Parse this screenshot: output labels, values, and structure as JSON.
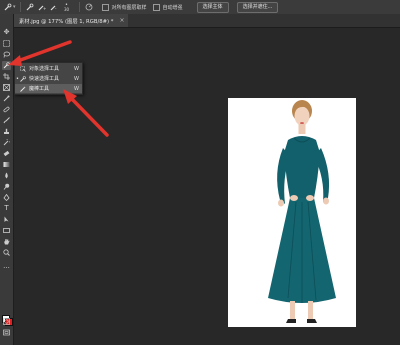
{
  "options_bar": {
    "sample_all_layers_label": "对所有图层取样",
    "auto_enhance_label": "自动增强",
    "select_subject_label": "选择主体",
    "select_and_mask_label": "选择并遮住...",
    "brush_size": "30"
  },
  "document_tab": {
    "title": "素材.jpg @ 177% (图层 1, RGB/8#) *",
    "close_glyph": "×"
  },
  "flyout": {
    "items": [
      {
        "label": "对象选择工具",
        "shortcut": "W",
        "bullet": "",
        "icon": "object-selection-icon"
      },
      {
        "label": "快速选择工具",
        "shortcut": "W",
        "bullet": "•",
        "icon": "quick-selection-icon"
      },
      {
        "label": "魔棒工具",
        "shortcut": "W",
        "bullet": "",
        "icon": "magic-wand-icon"
      }
    ]
  },
  "colors": {
    "arrow": "#e0342c",
    "dress": "#12606b",
    "foreground": "#ffffff",
    "background": "#e02020"
  }
}
